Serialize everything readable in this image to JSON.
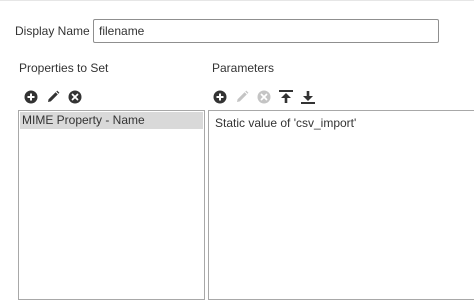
{
  "form": {
    "display_name_label": "Display Name",
    "display_name_value": "filename"
  },
  "properties": {
    "header": "Properties to Set",
    "toolbar": [
      "add-icon",
      "edit-icon",
      "remove-icon"
    ],
    "items": [
      {
        "label": "MIME Property - Name",
        "selected": true
      }
    ]
  },
  "parameters": {
    "header": "Parameters",
    "toolbar": [
      "add-icon",
      "edit-icon-disabled",
      "remove-icon-disabled",
      "move-to-top-icon",
      "move-to-bottom-icon"
    ],
    "items": [
      {
        "label": "Static value of 'csv_import'"
      }
    ]
  },
  "colors": {
    "icon": "#333333",
    "icon_disabled": "#bfbfbf",
    "selection": "#d9d9d9",
    "border": "#a8a8a8"
  }
}
